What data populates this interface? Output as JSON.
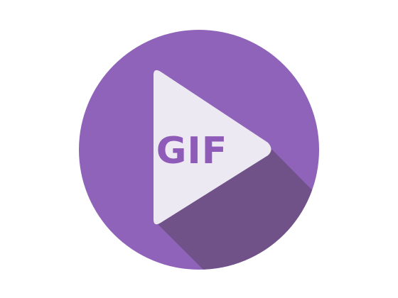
{
  "icon": {
    "name": "gif-player-app-icon",
    "label": "GIF",
    "colors": {
      "circle": "#8E63B9",
      "shadow": "#705289",
      "play_triangle": "#EDE9F2",
      "label_text": "#8E5BB8",
      "background": "#FFFFFF"
    }
  }
}
